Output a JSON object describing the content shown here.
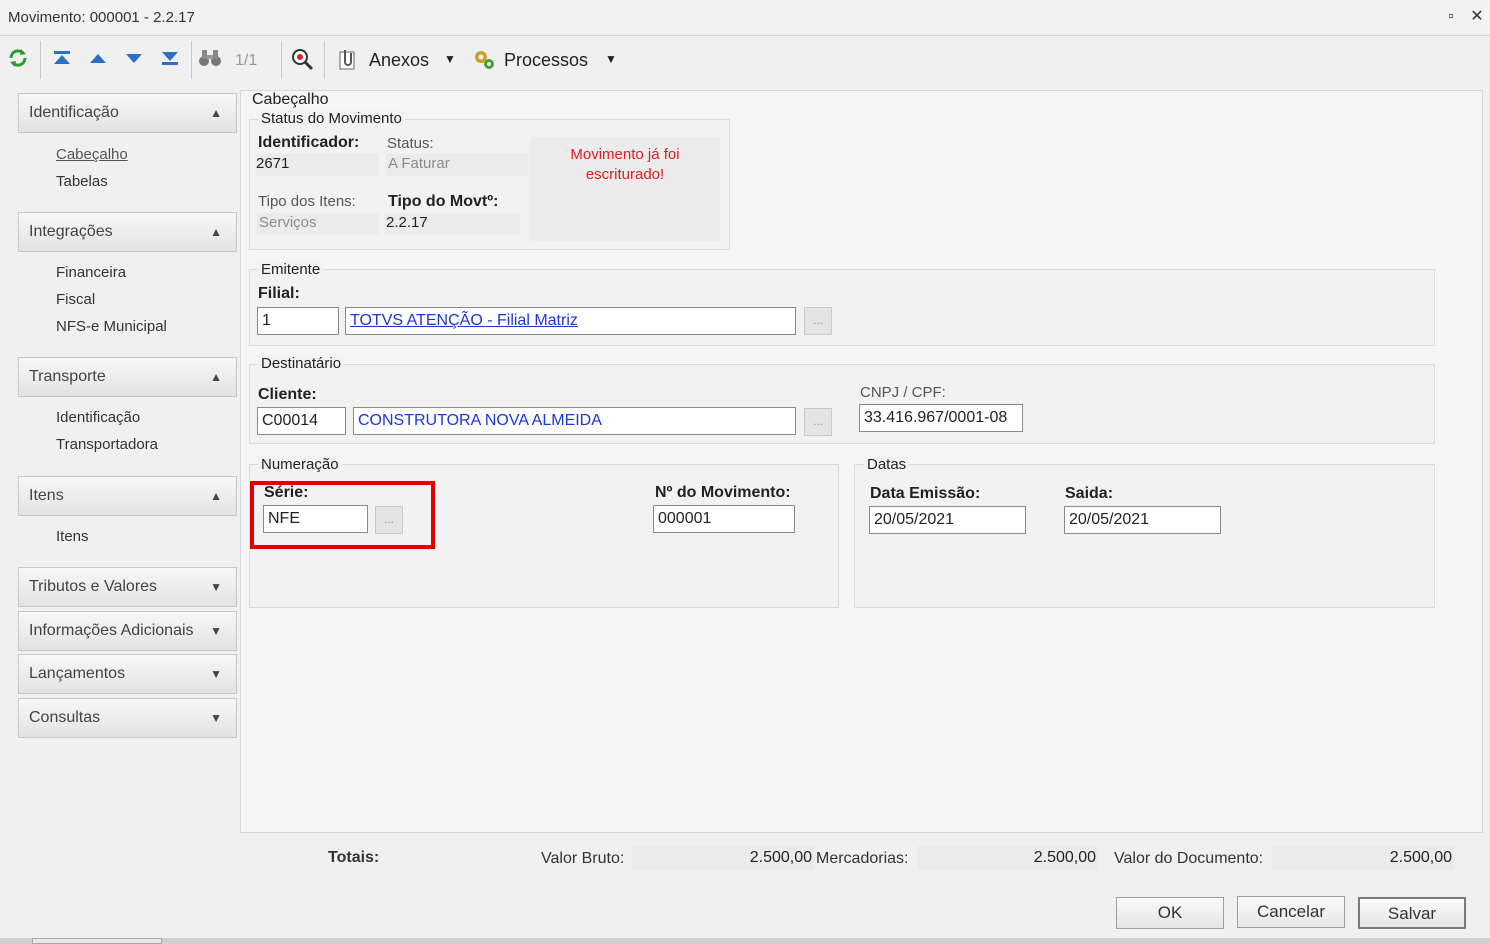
{
  "window": {
    "title": "Movimento: 000001 - 2.2.17",
    "maximize_glyph": "▫",
    "close_glyph": "✕"
  },
  "toolbar": {
    "page_indicator": "1/1",
    "anexos_label": "Anexos",
    "processos_label": "Processos",
    "icons": [
      "refresh-icon",
      "first-record-icon",
      "previous-record-icon",
      "next-record-icon",
      "last-record-icon",
      "binoculars-icon",
      "search-zoom-icon",
      "attachments-icon",
      "processes-icon"
    ]
  },
  "sidebar": {
    "sections": [
      {
        "label": "Identificação",
        "items": [
          "Cabeçalho",
          "Tabelas"
        ]
      },
      {
        "label": "Integrações",
        "items": [
          "Financeira",
          "Fiscal",
          "NFS-e Municipal"
        ]
      },
      {
        "label": "Transporte",
        "items": [
          "Identificação",
          "Transportadora"
        ]
      },
      {
        "label": "Itens",
        "items": [
          "Itens"
        ]
      },
      {
        "label": "Tributos e Valores",
        "items": []
      },
      {
        "label": "Informações Adicionais",
        "items": []
      },
      {
        "label": "Lançamentos",
        "items": []
      },
      {
        "label": "Consultas",
        "items": []
      }
    ]
  },
  "main": {
    "section_title": "Cabeçalho",
    "status_group": {
      "title": "Status do Movimento",
      "identificador_label": "Identificador:",
      "identificador_value": "2671",
      "status_label": "Status:",
      "status_value": "A Faturar",
      "tipo_itens_label": "Tipo dos Itens:",
      "tipo_itens_value": "Serviços",
      "tipo_movto_label": "Tipo do Movtº:",
      "tipo_movto_value": "2.2.17",
      "note_line1": "Movimento já foi",
      "note_line2": "escriturado!"
    },
    "emitente": {
      "title": "Emitente",
      "filial_label": "Filial:",
      "filial_code": "1",
      "filial_name": "TOTVS ATENÇÃO - Filial Matriz",
      "lookup_label": "..."
    },
    "destinatario": {
      "title": "Destinatário",
      "cliente_label": "Cliente:",
      "cliente_code": "C00014",
      "cliente_name": "CONSTRUTORA NOVA ALMEIDA",
      "lookup_label": "...",
      "cnpj_label": "CNPJ / CPF:",
      "cnpj_value": "33.416.967/0001-08"
    },
    "numeracao": {
      "title": "Numeração",
      "serie_label": "Série:",
      "serie_value": "NFE",
      "lookup_label": "...",
      "numero_label": "Nº do Movimento:",
      "numero_value": "000001"
    },
    "datas": {
      "title": "Datas",
      "emissao_label": "Data Emissão:",
      "emissao_value": "20/05/2021",
      "saida_label": "Saida:",
      "saida_value": "20/05/2021"
    }
  },
  "totals": {
    "title": "Totais:",
    "valor_bruto_label": "Valor Bruto:",
    "valor_bruto_value": "2.500,00",
    "mercadorias_label": "Mercadorias:",
    "mercadorias_value": "2.500,00",
    "valor_documento_label": "Valor do Documento:",
    "valor_documento_value": "2.500,00"
  },
  "buttons": {
    "ok": "OK",
    "cancel": "Cancelar",
    "save": "Salvar"
  },
  "colors": {
    "highlight": "#e00000",
    "link": "#1a37d8",
    "note": "#e21b1b"
  }
}
